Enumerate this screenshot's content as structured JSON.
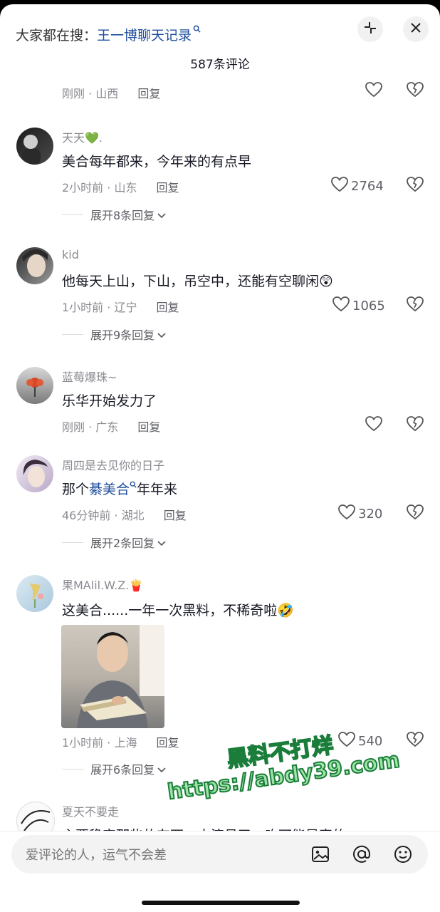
{
  "header": {
    "search_prefix": "大家都在搜：",
    "search_query": "王一博聊天记录",
    "comment_count": "587条评论"
  },
  "comments": [
    {
      "meta_time": "刚刚 · 山西",
      "reply": "回复"
    },
    {
      "username": "天天💚.",
      "text": "美合每年都来，今年来的有点早",
      "meta_time": "2小时前 · 山东",
      "reply": "回复",
      "likes": "2764",
      "expand": "展开8条回复"
    },
    {
      "username": "kid",
      "text": "他每天上山，下山，吊空中，还能有空聊闲😲",
      "meta_time": "1小时前 · 辽宁",
      "reply": "回复",
      "likes": "1065",
      "expand": "展开9条回复"
    },
    {
      "username": "蓝莓爆珠~",
      "text": "乐华开始发力了",
      "meta_time": "刚刚 · 广东",
      "reply": "回复"
    },
    {
      "username": "周四是去见你的日子",
      "text_prefix": "那个",
      "text_link": "綦美合",
      "text_suffix": "年年来",
      "meta_time": "46分钟前 · 湖北",
      "reply": "回复",
      "likes": "320",
      "expand": "展开2条回复"
    },
    {
      "username": "果MAlil.W.Z.🍟",
      "text": "这美合......一年一次黑料，不稀奇啦🤣",
      "meta_time": "1小时前 · 上海",
      "reply": "回复",
      "likes": "540",
      "expand": "展开6条回复"
    },
    {
      "username": "夏天不要走",
      "text": "主要稳定那些的东西，大演员了，咋可能是真的"
    }
  ],
  "input": {
    "placeholder": "爱评论的人，运气不会差"
  },
  "watermark": {
    "line1": "黑料不打烊",
    "line2": "https://abdy39.com"
  },
  "icons": [
    "shrink-icon",
    "close-icon",
    "heart-icon",
    "broken-heart-icon",
    "chevron-down-icon",
    "image-icon",
    "at-icon",
    "emoji-icon"
  ],
  "colors": {
    "link": "#1f4e9c",
    "secondary_text": "#8a8b91",
    "watermark_fill": "#9ee5a6",
    "watermark_stroke": "#1a7d3a"
  }
}
